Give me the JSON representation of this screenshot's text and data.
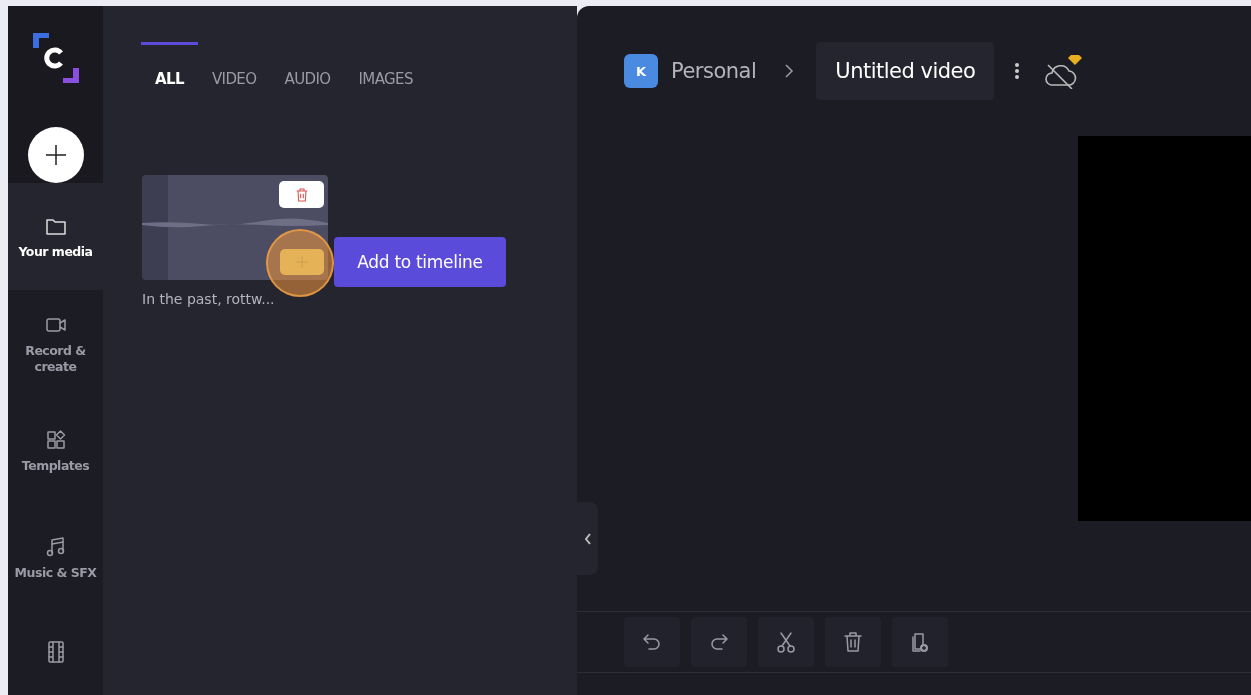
{
  "sidebar": {
    "items": [
      {
        "kind": "folder",
        "label": "Your media",
        "selected": true
      },
      {
        "kind": "camera",
        "label": "Record &\ncreate",
        "selected": false
      },
      {
        "kind": "templates",
        "label": "Templates",
        "selected": false
      },
      {
        "kind": "music",
        "label": "Music & SFX",
        "selected": false
      },
      {
        "kind": "film",
        "selected": false
      }
    ]
  },
  "media_panel": {
    "tabs": [
      {
        "label": "ALL",
        "selected": true
      },
      {
        "label": "VIDEO",
        "selected": false
      },
      {
        "label": "AUDIO",
        "selected": false
      },
      {
        "label": "IMAGES",
        "selected": false
      }
    ],
    "items": [
      {
        "title": "In the past, rottw...",
        "tooltip": "Add to timeline"
      }
    ]
  },
  "header": {
    "workspace_initial": "K",
    "workspace": "Personal",
    "project_title": "Untitled video"
  },
  "toolbar": [
    {
      "kind": "undo"
    },
    {
      "kind": "redo"
    },
    {
      "kind": "cut"
    },
    {
      "kind": "delete"
    },
    {
      "kind": "add-media"
    }
  ]
}
